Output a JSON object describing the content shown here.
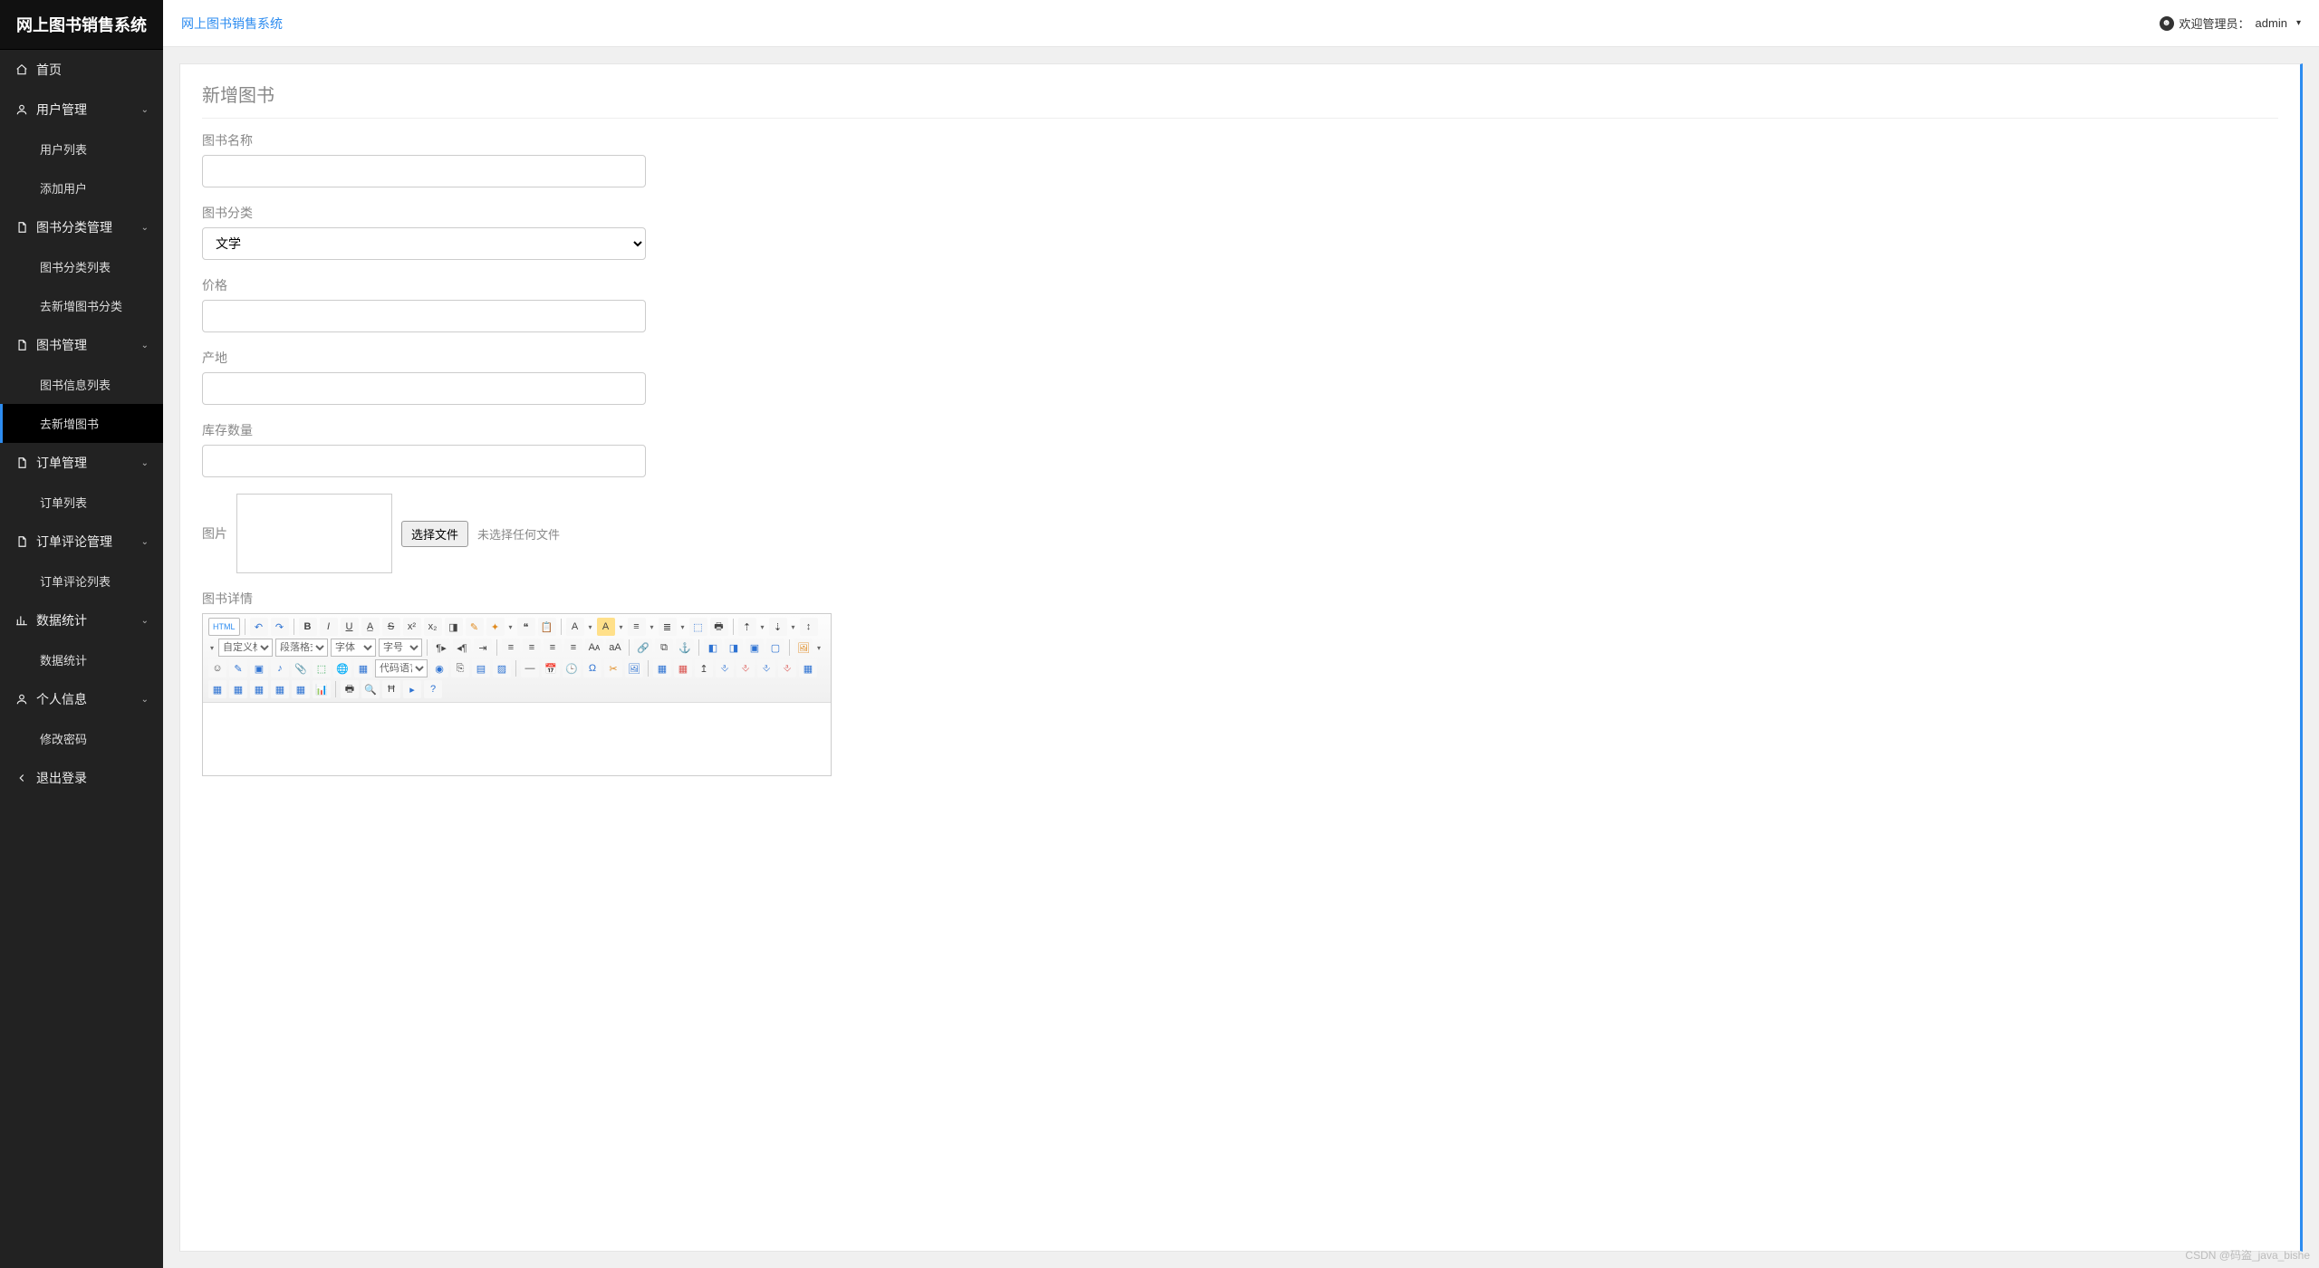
{
  "app_title": "网上图书销售系统",
  "topbar": {
    "breadcrumb": "网上图书销售系统",
    "welcome_prefix": "欢迎管理员：",
    "username": "admin"
  },
  "sidebar": {
    "home": "首页",
    "groups": [
      {
        "label": "用户管理",
        "icon": "user",
        "items": [
          "用户列表",
          "添加用户"
        ],
        "active_index": -1
      },
      {
        "label": "图书分类管理",
        "icon": "doc",
        "items": [
          "图书分类列表",
          "去新增图书分类"
        ],
        "active_index": -1
      },
      {
        "label": "图书管理",
        "icon": "doc",
        "items": [
          "图书信息列表",
          "去新增图书"
        ],
        "active_index": 1
      },
      {
        "label": "订单管理",
        "icon": "doc",
        "items": [
          "订单列表"
        ],
        "active_index": -1
      },
      {
        "label": "订单评论管理",
        "icon": "doc",
        "items": [
          "订单评论列表"
        ],
        "active_index": -1
      },
      {
        "label": "数据统计",
        "icon": "stats",
        "items": [
          "数据统计"
        ],
        "active_index": -1
      },
      {
        "label": "个人信息",
        "icon": "user",
        "items": [
          "修改密码"
        ],
        "active_index": -1
      }
    ],
    "logout": "退出登录"
  },
  "form": {
    "panel_title": "新增图书",
    "name_label": "图书名称",
    "category_label": "图书分类",
    "category_value": "文学",
    "price_label": "价格",
    "origin_label": "产地",
    "stock_label": "库存数量",
    "image_label": "图片",
    "file_button": "选择文件",
    "file_status": "未选择任何文件",
    "detail_label": "图书详情"
  },
  "editor": {
    "html_btn": "HTML",
    "sel_custom": "自定义标题",
    "sel_para": "段落格式",
    "sel_font": "字体",
    "sel_size": "字号",
    "sel_code": "代码语言"
  },
  "watermark": "CSDN @码盗_java_bishe"
}
